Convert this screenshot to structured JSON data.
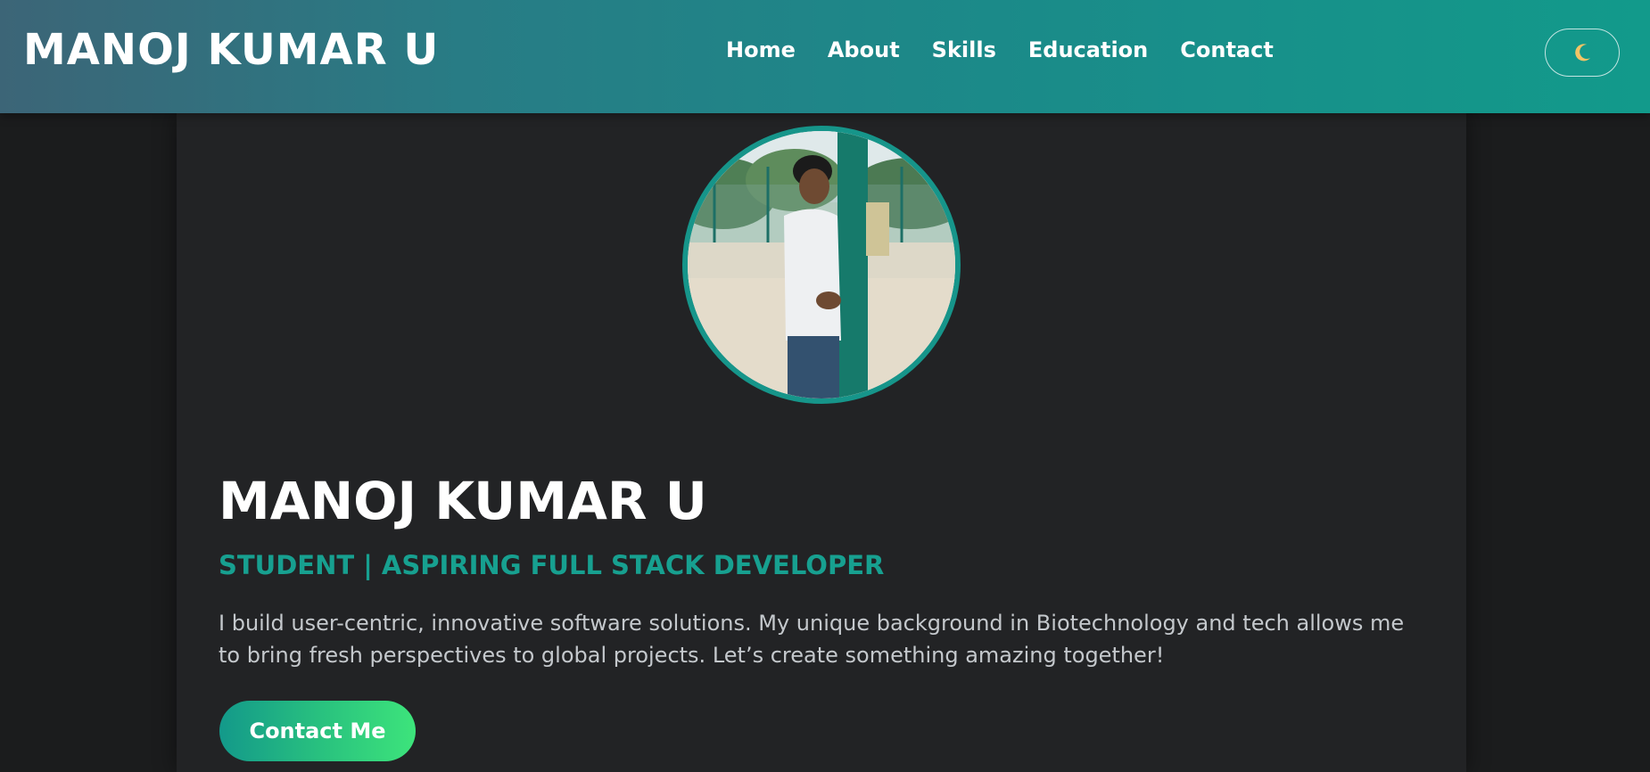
{
  "header": {
    "brand": "MANOJ KUMAR U",
    "nav": [
      {
        "label": "Home"
      },
      {
        "label": "About"
      },
      {
        "label": "Skills"
      },
      {
        "label": "Education"
      },
      {
        "label": "Contact"
      }
    ],
    "theme_toggle_icon": "crescent-moon-icon"
  },
  "hero": {
    "name": "MANOJ KUMAR U",
    "subtitle": "STUDENT | ASPIRING FULL STACK DEVELOPER",
    "description": "I build user-centric, innovative software solutions. My unique background in Biotechnology and tech allows me to bring fresh perspectives to global projects. Let’s create something amazing together!",
    "cta_label": "Contact Me"
  },
  "colors": {
    "accent": "#16958a",
    "cta_gradient_start": "#13998a",
    "cta_gradient_end": "#3de47b",
    "background": "#1b1c1d",
    "panel": "#222325"
  }
}
